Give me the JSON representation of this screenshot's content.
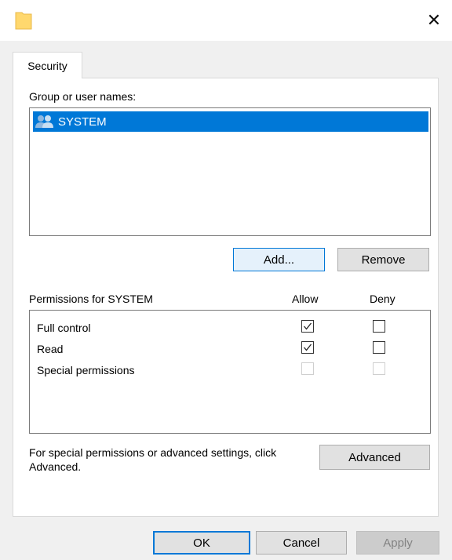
{
  "window": {
    "close_label": "✕"
  },
  "tabs": [
    {
      "label": "Security"
    }
  ],
  "group_section": {
    "label": "Group or user names:",
    "users": [
      {
        "name": "SYSTEM",
        "selected": true,
        "icon": "users-group-icon"
      }
    ],
    "add_label": "Add...",
    "remove_label": "Remove"
  },
  "permissions": {
    "label": "Permissions for SYSTEM",
    "allow_header": "Allow",
    "deny_header": "Deny",
    "rows": [
      {
        "name": "Full control",
        "allow": true,
        "deny": false,
        "enabled": true
      },
      {
        "name": "Read",
        "allow": true,
        "deny": false,
        "enabled": true
      },
      {
        "name": "Special permissions",
        "allow": false,
        "deny": false,
        "enabled": false
      }
    ]
  },
  "advanced": {
    "text": "For special permissions or advanced settings, click Advanced.",
    "button_label": "Advanced"
  },
  "footer": {
    "ok_label": "OK",
    "cancel_label": "Cancel",
    "apply_label": "Apply"
  },
  "colors": {
    "accent": "#0078d7",
    "selection": "#0078d7",
    "folder": "#ffd86e"
  }
}
